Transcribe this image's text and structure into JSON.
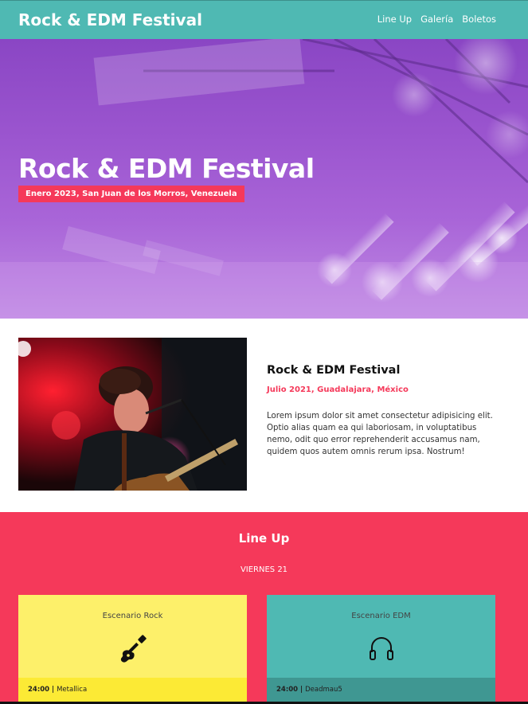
{
  "header": {
    "brand": "Rock & EDM Festival",
    "nav": [
      "Line Up",
      "Galería",
      "Boletos"
    ]
  },
  "hero": {
    "title": "Rock & EDM Festival",
    "badge": "Enero 2023, San Juan de los Morros, Venezuela"
  },
  "about": {
    "title": "Rock & EDM Festival",
    "date": "Julio 2021, Guadalajara, México",
    "text": "Lorem ipsum dolor sit amet consectetur adipisicing elit. Optio alias quam ea qui laboriosam, in voluptatibus nemo, odit quo error reprehenderit accusamus nam, quidem quos autem omnis rerum ipsa. Nostrum!"
  },
  "lineup": {
    "title": "Line Up",
    "day": "VIERNES 21",
    "stages": [
      {
        "name": "Escenario Rock",
        "icon": "guitar-icon",
        "time": "24:00",
        "separator": " | ",
        "artist": "Metallica"
      },
      {
        "name": "Escenario EDM",
        "icon": "headphones-icon",
        "time": "24:00",
        "separator": " | ",
        "artist": "Deadmau5"
      }
    ]
  },
  "colors": {
    "teal": "#4fb9b3",
    "accent": "#f5395a",
    "yellow": "#fdf06a",
    "hero_purple": "#9b55cf"
  }
}
